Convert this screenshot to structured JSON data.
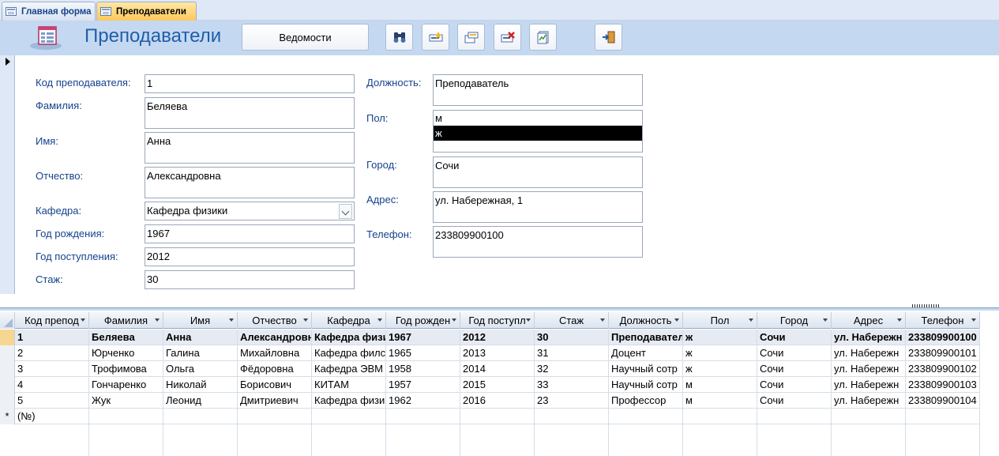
{
  "tabs": [
    {
      "label": "Главная форма",
      "active": false
    },
    {
      "label": "Преподаватели",
      "active": true
    }
  ],
  "header": {
    "title": "Преподаватели",
    "report_button": "Ведомости",
    "toolbar_icons": [
      "find-icon",
      "new-record-icon",
      "add-record-icon",
      "delete-record-icon",
      "report-icon",
      "exit-icon"
    ]
  },
  "form": {
    "teacher_id": {
      "label": "Код преподавателя:",
      "value": "1"
    },
    "last_name": {
      "label": "Фамилия:",
      "value": "Беляева"
    },
    "first_name": {
      "label": "Имя:",
      "value": "Анна"
    },
    "patronymic": {
      "label": "Отчество:",
      "value": "Александровна"
    },
    "department": {
      "label": "Кафедра:",
      "value": "Кафедра физики"
    },
    "birth_year": {
      "label": "Год рождения:",
      "value": "1967"
    },
    "hire_year": {
      "label": "Год поступления:",
      "value": "2012"
    },
    "experience": {
      "label": "Стаж:",
      "value": "30"
    },
    "position": {
      "label": "Должность:",
      "value": "Преподаватель"
    },
    "gender": {
      "label": "Пол:",
      "options": [
        "м",
        "ж"
      ],
      "selected": "ж"
    },
    "city": {
      "label": "Город:",
      "value": "Сочи"
    },
    "address": {
      "label": "Адрес:",
      "value": "ул. Набережная, 1"
    },
    "phone": {
      "label": "Телефон:",
      "value": "233809900100"
    }
  },
  "datasheet": {
    "columns": [
      "Код препод",
      "Фамилия",
      "Имя",
      "Отчество",
      "Кафедра",
      "Год рожден",
      "Год поступл",
      "Стаж",
      "Должность",
      "Пол",
      "Город",
      "Адрес",
      "Телефон"
    ],
    "rows": [
      [
        "1",
        "Беляева",
        "Анна",
        "Александровн",
        "Кафедра физи",
        "1967",
        "2012",
        "30",
        "Преподавател",
        "ж",
        "Сочи",
        "ул. Набережн",
        "233809900100"
      ],
      [
        "2",
        "Юрченко",
        "Галина",
        "Михайловна",
        "Кафедра филс",
        "1965",
        "2013",
        "31",
        "Доцент",
        "ж",
        "Сочи",
        "ул. Набережн",
        "233809900101"
      ],
      [
        "3",
        "Трофимова",
        "Ольга",
        "Фёдоровна",
        "Кафедра ЭВМ",
        "1958",
        "2014",
        "32",
        "Научный сотр",
        "ж",
        "Сочи",
        "ул. Набережн",
        "233809900102"
      ],
      [
        "4",
        "Гончаренко",
        "Николай",
        "Борисович",
        "КИТАМ",
        "1957",
        "2015",
        "33",
        "Научный сотр",
        "м",
        "Сочи",
        "ул. Набережн",
        "233809900103"
      ],
      [
        "5",
        "Жук",
        "Леонид",
        "Дмитриевич",
        "Кафедра физи",
        "1962",
        "2016",
        "23",
        "Профессор",
        "м",
        "Сочи",
        "ул. Набережн",
        "233809900104"
      ]
    ],
    "new_row_marker": "*",
    "new_row_placeholder": "(№)"
  }
}
